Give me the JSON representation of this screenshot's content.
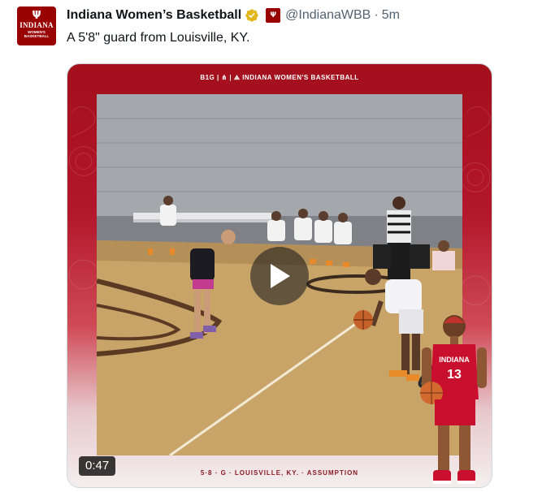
{
  "account": {
    "display_name": "Indiana Women’s Basketball",
    "handle": "@IndianaWBB",
    "separator": "·",
    "timestamp": "5m",
    "avatar_line1": "INDIANA",
    "avatar_line2": "WOMEN'S\nBASKETBALL",
    "verified_color": "#e2b719",
    "avatar_icon": "indiana-trident-logo",
    "mini_logo_text": "INDIANA"
  },
  "tweet": {
    "text": "A 5'8\" guard from Louisville, KY."
  },
  "media": {
    "banner": "B1G | ⋔ | ⟁ INDIANA WOMEN'S BASKETBALL",
    "caption": "5·8 · G · LOUISVILLE, KY. · ASSUMPTION",
    "duration": "0:47",
    "play_icon": "play-icon",
    "player_jersey_text": "INDIANA",
    "player_number": "13"
  },
  "colors": {
    "brand_crimson": "#990000",
    "text_primary": "#0f1419",
    "text_secondary": "#536471"
  }
}
